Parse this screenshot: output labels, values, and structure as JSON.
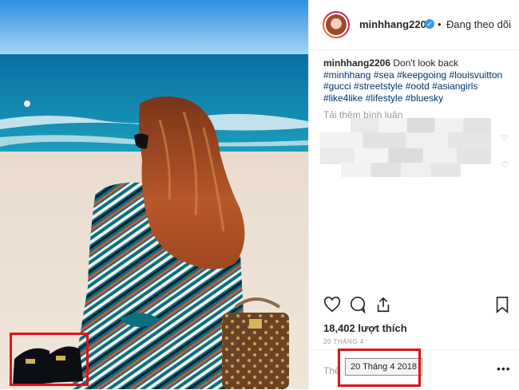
{
  "header": {
    "username": "minhhang2206",
    "separator": "•",
    "follow_label": "Đang theo dõi"
  },
  "caption": {
    "username": "minhhang2206",
    "text": " Don't look back",
    "hashtags": [
      "#minhhang",
      "#sea",
      "#keepgoing",
      "#louisvuitton",
      "#gucci",
      "#streetstyle",
      "#ootd",
      "#asiangirls",
      "#like4like",
      "#lifestyle",
      "#bluesky"
    ]
  },
  "comments": {
    "load_more": "Tải thêm bình luận"
  },
  "actions": {
    "like_icon": "heart-icon",
    "comment_icon": "comment-icon",
    "share_icon": "share-icon",
    "save_icon": "bookmark-icon"
  },
  "likes_text": "18,402 lượt thích",
  "date_small": "20 THÁNG 4",
  "comment_placeholder": "Thê",
  "more_label": "•••",
  "tooltip_date": "20 Tháng 4 2018",
  "colors": {
    "highlight": "#e0121b",
    "link": "#003569",
    "verified": "#3897f0"
  }
}
